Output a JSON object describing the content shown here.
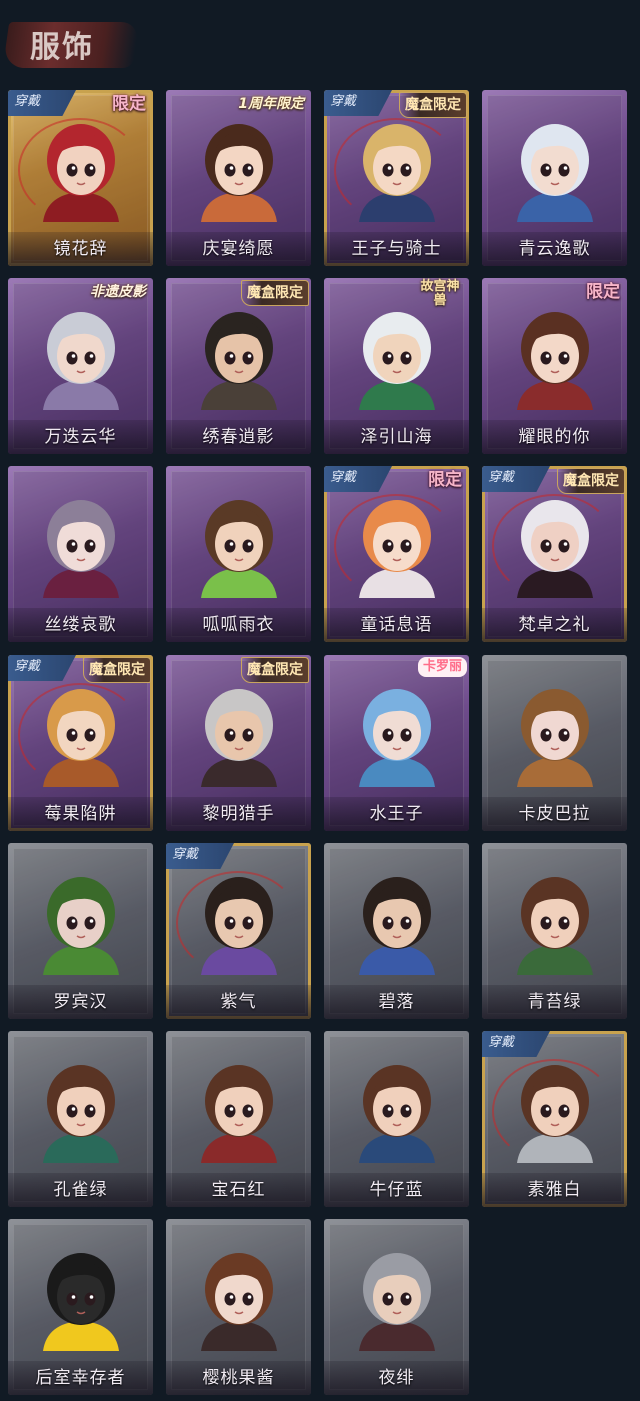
{
  "header": {
    "title": "服饰"
  },
  "labels": {
    "worn": "穿戴"
  },
  "colors": {
    "background": "#111a24",
    "purple_card": "#6f4c8c",
    "gray_card": "#626570",
    "gold_card": "#b98a3e",
    "worn_tag": "#3a5c8e"
  },
  "cards": [
    {
      "name": "镜花辞",
      "style": "gold",
      "worn": true,
      "badge": "限定",
      "badge_type": "limited",
      "hair": "#b3262e",
      "skin": "#f1d2c0",
      "cloth": "#8e1c22"
    },
    {
      "name": "庆宴绮愿",
      "style": "purple",
      "worn": false,
      "badge": "1周年限定",
      "badge_type": "anniv",
      "hair": "#4a2a1c",
      "skin": "#f3d6c3",
      "cloth": "#c96a3a"
    },
    {
      "name": "王子与骑士",
      "style": "purple",
      "worn": true,
      "badge": "魔盒限定",
      "badge_type": "box",
      "hair": "#d9b46a",
      "skin": "#f4d8c4",
      "cloth": "#2c3e6e"
    },
    {
      "name": "青云逸歌",
      "style": "purple",
      "worn": false,
      "badge": "",
      "badge_type": "",
      "hair": "#dfe6f0",
      "skin": "#f2dcd0",
      "cloth": "#3a63a8"
    },
    {
      "name": "万迭云华",
      "style": "purple",
      "worn": false,
      "badge": "非遗皮影",
      "badge_type": "shadow",
      "hair": "#c9ccd6",
      "skin": "#f0d8cc",
      "cloth": "#8a7aa8"
    },
    {
      "name": "绣春逍影",
      "style": "purple",
      "worn": false,
      "badge": "魔盒限定",
      "badge_type": "box",
      "hair": "#2a2420",
      "skin": "#e6c3a8",
      "cloth": "#4a4038"
    },
    {
      "name": "泽引山海",
      "style": "purple",
      "worn": false,
      "badge": "故宫神兽",
      "badge_type": "palace",
      "hair": "#e8ecef",
      "skin": "#f0d4bc",
      "cloth": "#2f7a4c"
    },
    {
      "name": "耀眼的你",
      "style": "purple",
      "worn": false,
      "badge": "限定",
      "badge_type": "limited",
      "hair": "#5a3022",
      "skin": "#f3d8c8",
      "cloth": "#8a2c2c"
    },
    {
      "name": "丝缕哀歌",
      "style": "purple",
      "worn": false,
      "badge": "",
      "badge_type": "",
      "hair": "#8c7f98",
      "skin": "#f0dcd8",
      "cloth": "#6a2040"
    },
    {
      "name": "呱呱雨衣",
      "style": "purple",
      "worn": false,
      "badge": "",
      "badge_type": "",
      "hair": "#5a3a26",
      "skin": "#f0d2bc",
      "cloth": "#7ac04a"
    },
    {
      "name": "童话息语",
      "style": "purple",
      "worn": true,
      "badge": "限定",
      "badge_type": "limited",
      "hair": "#e88a4a",
      "skin": "#f6dccb",
      "cloth": "#e8e0e4"
    },
    {
      "name": "梵卓之礼",
      "style": "purple",
      "worn": true,
      "badge": "魔盒限定",
      "badge_type": "box",
      "hair": "#e9e6ec",
      "skin": "#efd0c4",
      "cloth": "#2a1a22"
    },
    {
      "name": "莓果陷阱",
      "style": "purple",
      "worn": true,
      "badge": "魔盒限定",
      "badge_type": "box",
      "hair": "#d89a4a",
      "skin": "#f2d6c0",
      "cloth": "#a85a2a"
    },
    {
      "name": "黎明猎手",
      "style": "purple",
      "worn": false,
      "badge": "魔盒限定",
      "badge_type": "box",
      "hair": "#c8c6c6",
      "skin": "#e8c6ac",
      "cloth": "#3a2a2c"
    },
    {
      "name": "水王子",
      "style": "purple",
      "worn": false,
      "badge": "卡罗丽",
      "badge_type": "carol",
      "hair": "#7ab0e0",
      "skin": "#f0dcd4",
      "cloth": "#4a8ac0"
    },
    {
      "name": "卡皮巴拉",
      "style": "gray",
      "worn": false,
      "badge": "",
      "badge_type": "",
      "hair": "#8a5a30",
      "skin": "#f0d8d2",
      "cloth": "#a86c38"
    },
    {
      "name": "罗宾汉",
      "style": "gray",
      "worn": false,
      "badge": "",
      "badge_type": "",
      "hair": "#3a6a2a",
      "skin": "#e8d0c8",
      "cloth": "#4a8a34"
    },
    {
      "name": "紫气",
      "style": "gray",
      "worn": true,
      "badge": "",
      "badge_type": "",
      "hair": "#2a201c",
      "skin": "#e8c8b0",
      "cloth": "#6a4aa0"
    },
    {
      "name": "碧落",
      "style": "gray",
      "worn": false,
      "badge": "",
      "badge_type": "",
      "hair": "#2a201c",
      "skin": "#e8c8b0",
      "cloth": "#3a5aa8"
    },
    {
      "name": "青苔绿",
      "style": "gray",
      "worn": false,
      "badge": "",
      "badge_type": "",
      "hair": "#5a3424",
      "skin": "#f0d0bc",
      "cloth": "#3a6a3a"
    },
    {
      "name": "孔雀绿",
      "style": "gray",
      "worn": false,
      "badge": "",
      "badge_type": "",
      "hair": "#5a3424",
      "skin": "#f0d0bc",
      "cloth": "#2a6a5a"
    },
    {
      "name": "宝石红",
      "style": "gray",
      "worn": false,
      "badge": "",
      "badge_type": "",
      "hair": "#5a3424",
      "skin": "#f0d0bc",
      "cloth": "#8a2a2a"
    },
    {
      "name": "牛仔蓝",
      "style": "gray",
      "worn": false,
      "badge": "",
      "badge_type": "",
      "hair": "#5a3424",
      "skin": "#f0d0bc",
      "cloth": "#2a4a7a"
    },
    {
      "name": "素雅白",
      "style": "gray",
      "worn": true,
      "badge": "",
      "badge_type": "",
      "hair": "#5a3424",
      "skin": "#f0d0bc",
      "cloth": "#b0b4ba"
    },
    {
      "name": "后室幸存者",
      "style": "gray",
      "worn": false,
      "badge": "",
      "badge_type": "",
      "hair": "#1a1a1a",
      "skin": "#2a2a2a",
      "cloth": "#f0c81e"
    },
    {
      "name": "樱桃果酱",
      "style": "gray",
      "worn": false,
      "badge": "",
      "badge_type": "",
      "hair": "#6a3a24",
      "skin": "#f0d8cc",
      "cloth": "#3a2a2a"
    },
    {
      "name": "夜绯",
      "style": "gray",
      "worn": false,
      "badge": "",
      "badge_type": "",
      "hair": "#9a9ca4",
      "skin": "#e8cebc",
      "cloth": "#4a2a2e"
    }
  ]
}
